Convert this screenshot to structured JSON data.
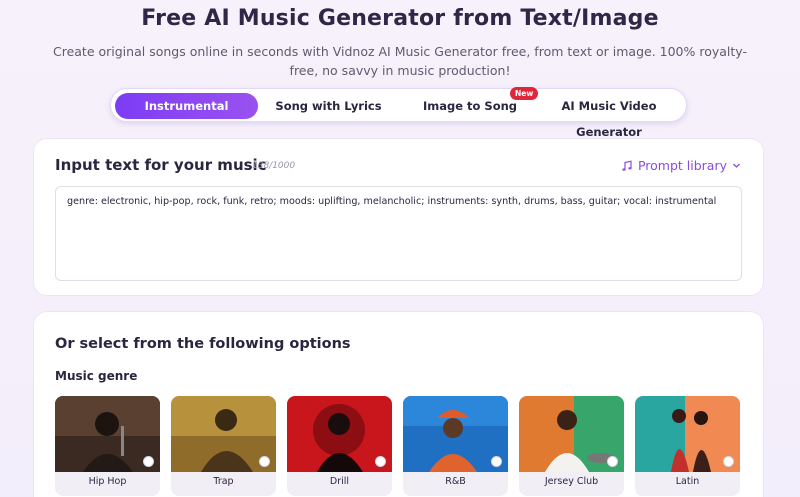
{
  "header": {
    "title": "Free AI Music Generator from Text/Image",
    "subtitle": "Create original songs online in seconds with Vidnoz AI Music Generator free, from text or image. 100% royalty-free, no savvy in music production!"
  },
  "tabs": [
    {
      "label": "Instrumental",
      "active": true
    },
    {
      "label": "Song with Lyrics",
      "active": false
    },
    {
      "label": "Image to Song",
      "active": false,
      "badge": "New"
    },
    {
      "label": "AI Music Video Generator",
      "active": false
    }
  ],
  "input": {
    "title": "Input text for your music",
    "char_count": "138/1000",
    "prompt_library_label": "Prompt library",
    "prompt_text": "genre: electronic, hip-pop, rock, funk, retro; moods: uplifting, melancholic; instruments: synth, drums, bass, guitar; vocal: instrumental"
  },
  "options": {
    "title": "Or select from the following options",
    "genre_label": "Music genre",
    "genres": [
      {
        "name": "Hip Hop"
      },
      {
        "name": "Trap"
      },
      {
        "name": "Drill"
      },
      {
        "name": "R&B"
      },
      {
        "name": "Jersey Club"
      },
      {
        "name": "Latin"
      }
    ]
  },
  "colors": {
    "accent": "#8a4ce0",
    "tab_active": "#7d3cf5",
    "badge": "#e0263b"
  }
}
